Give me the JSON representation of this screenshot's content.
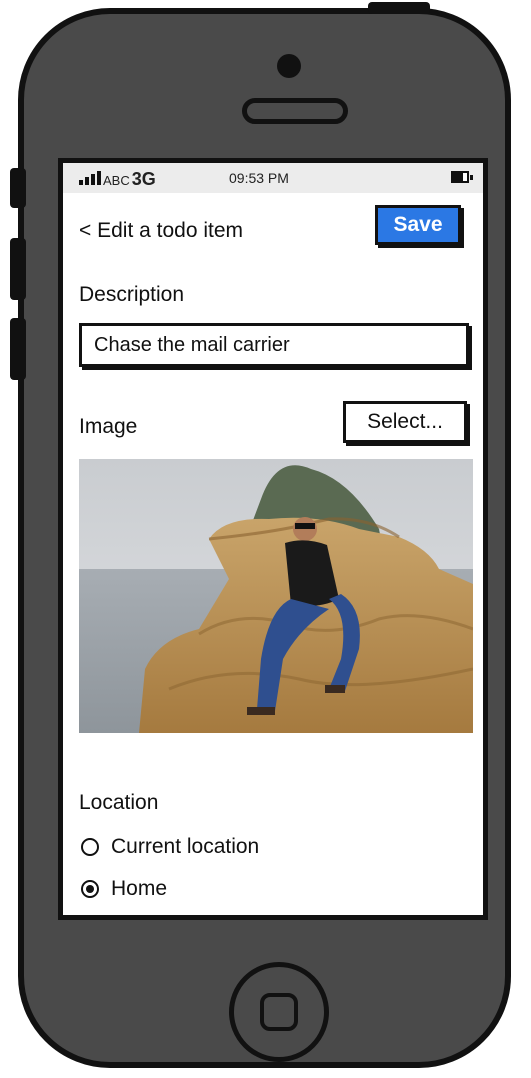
{
  "statusbar": {
    "carrier": "ABC",
    "network": "3G",
    "time": "09:53 PM"
  },
  "header": {
    "back_title": "< Edit a todo item",
    "save_label": "Save"
  },
  "form": {
    "description_label": "Description",
    "description_value": "Chase the mail carrier",
    "image_label": "Image",
    "select_label": "Select...",
    "location_label": "Location",
    "location_options": [
      {
        "label": "Current location",
        "selected": false
      },
      {
        "label": "Home",
        "selected": true
      }
    ]
  },
  "colors": {
    "accent": "#2b78e4",
    "device": "#4a4a4a"
  }
}
